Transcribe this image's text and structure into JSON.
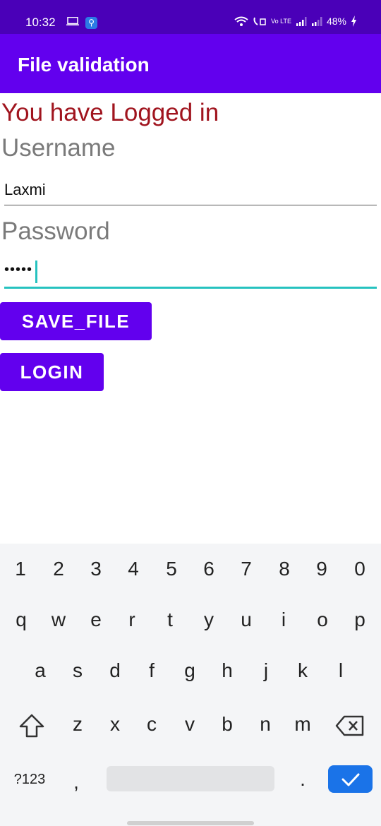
{
  "status_bar": {
    "time": "10:32",
    "battery": "48%",
    "network_label": "Vo LTE"
  },
  "app_bar": {
    "title": "File validation"
  },
  "status_message": "You have Logged in",
  "form": {
    "username_label": "Username",
    "username_value": "Laxmi",
    "password_label": "Password",
    "password_value": "•••••"
  },
  "buttons": {
    "save_file": "SAVE_FILE",
    "login": "LOGIN"
  },
  "keyboard": {
    "number_row": [
      "1",
      "2",
      "3",
      "4",
      "5",
      "6",
      "7",
      "8",
      "9",
      "0"
    ],
    "row1": [
      "q",
      "w",
      "e",
      "r",
      "t",
      "y",
      "u",
      "i",
      "o",
      "p"
    ],
    "row2": [
      "a",
      "s",
      "d",
      "f",
      "g",
      "h",
      "j",
      "k",
      "l"
    ],
    "row3": [
      "z",
      "x",
      "c",
      "v",
      "b",
      "n",
      "m"
    ],
    "symbols_key": "?123",
    "comma_key": ",",
    "period_key": "."
  },
  "colors": {
    "app_bar": "#6200ee",
    "status_bar": "#4a00b8",
    "message": "#a0141e",
    "focus_underline": "#26c2bf",
    "enter_key": "#1a73e8"
  }
}
